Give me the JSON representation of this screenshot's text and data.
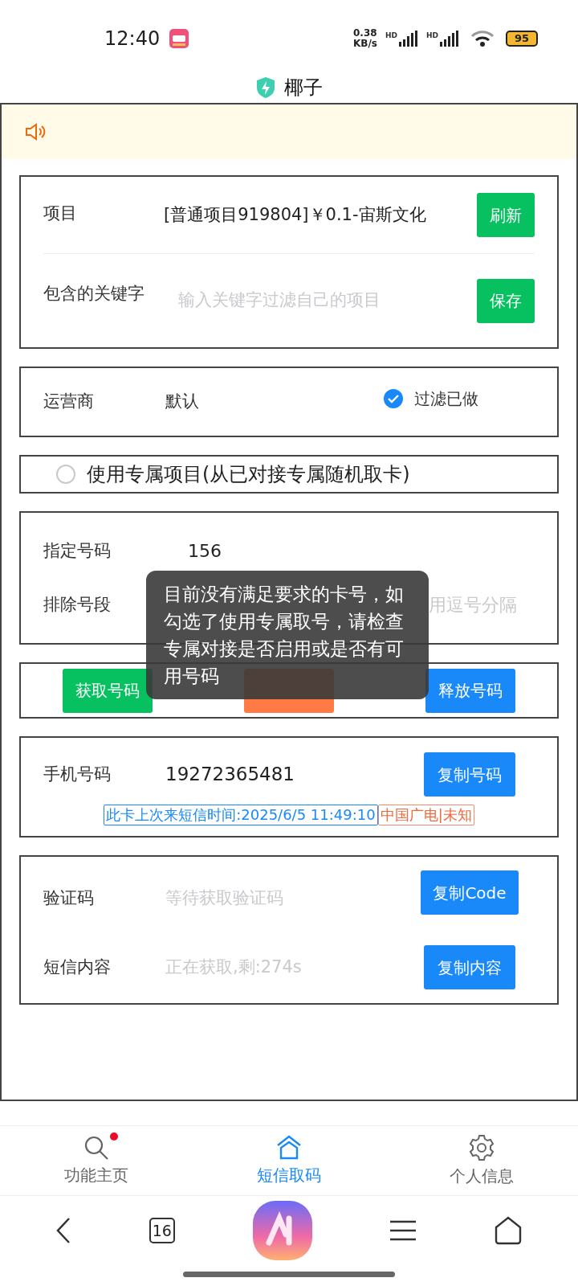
{
  "status_bar": {
    "time": "12:40",
    "speed_value": "0.38",
    "speed_unit": "KB/s",
    "sim_labels": [
      "HD",
      "HD"
    ],
    "battery": "95"
  },
  "header": {
    "title": "椰子"
  },
  "project_card": {
    "project_label": "项目",
    "project_value": "[普通项目919804]￥0.1-宙斯文化",
    "refresh_button": "刷新",
    "keyword_label": "包含的关键字",
    "keyword_placeholder": "输入关键字过滤自己的项目",
    "save_button": "保存"
  },
  "operator_card": {
    "label": "运营商",
    "value": "默认",
    "filter": {
      "label": "过滤已做",
      "checked": true
    }
  },
  "exclusive": {
    "label": "使用专属项目(从已对接专属随机取卡)",
    "selected": false
  },
  "number_card": {
    "assign_label": "指定号码",
    "assign_value": "156",
    "exclude_label": "排除号段",
    "exclude_placeholder": "用逗号分隔"
  },
  "actions": [
    {
      "label": "获取号码",
      "color": "#07c160"
    },
    {
      "color": "#ff7a45"
    },
    {
      "label": "释放号码",
      "color": "#1989fa"
    }
  ],
  "phone_card": {
    "label": "手机号码",
    "value": "19272365481",
    "copy_button": "复制号码",
    "last_sms_tag": "此卡上次来短信时间:2025/6/5 11:49:10",
    "carrier_tag": "中国广电|未知"
  },
  "sms_card": {
    "code_label": "验证码",
    "code_value": "等待获取验证码",
    "copy_code_button": "复制Code",
    "content_label": "短信内容",
    "content_value": "正在获取,剩:274s",
    "copy_content_button": "复制内容"
  },
  "toast": "目前没有满足要求的卡号，如勾选了使用专属取号，请检查专属对接是否启用或是否有可用号码",
  "tabbar": [
    {
      "label": "功能主页",
      "selected": false,
      "badge": true,
      "kind": "search"
    },
    {
      "label": "短信取码",
      "selected": true,
      "badge": false,
      "kind": "home"
    },
    {
      "label": "个人信息",
      "selected": false,
      "badge": false,
      "kind": "gear"
    }
  ],
  "browser_bar": {
    "tab_count": "16"
  }
}
